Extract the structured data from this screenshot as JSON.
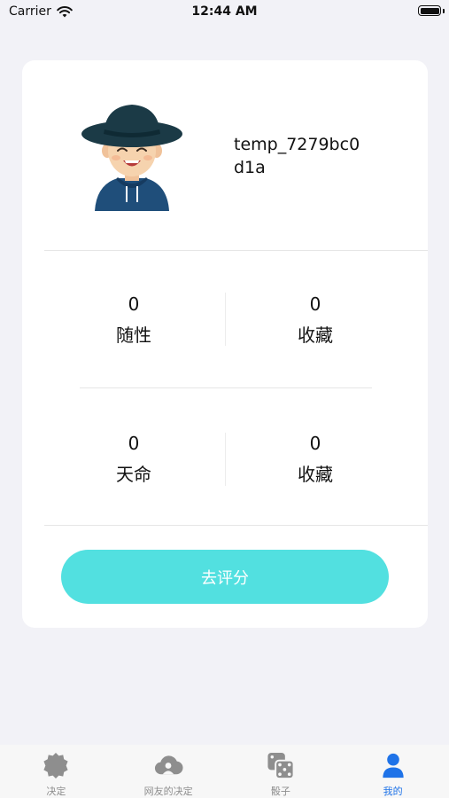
{
  "status_bar": {
    "carrier": "Carrier",
    "time": "12:44 AM"
  },
  "profile": {
    "username": "temp_7279bc0d1a",
    "avatar_icon": "cartoon-avatar-icon"
  },
  "stats": [
    {
      "value": "0",
      "label": "随性"
    },
    {
      "value": "0",
      "label": "收藏"
    },
    {
      "value": "0",
      "label": "天命"
    },
    {
      "value": "0",
      "label": "收藏"
    }
  ],
  "rate_button": {
    "label": "去评分",
    "color": "#52e0e0"
  },
  "tab_bar": {
    "active_color": "#1f73e8",
    "inactive_color": "#8e8e8e",
    "tabs": [
      {
        "label": "决定",
        "icon": "badge-icon",
        "active": false
      },
      {
        "label": "网友的决定",
        "icon": "cloud-user-icon",
        "active": false
      },
      {
        "label": "骰子",
        "icon": "dice-icon",
        "active": false
      },
      {
        "label": "我的",
        "icon": "person-icon",
        "active": true
      }
    ]
  }
}
